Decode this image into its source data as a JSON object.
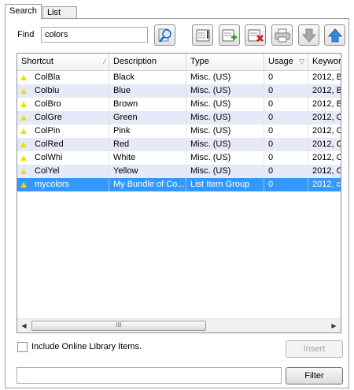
{
  "tabs": [
    {
      "label": "Search",
      "active": true
    },
    {
      "label": "List",
      "active": false
    }
  ],
  "find": {
    "label": "Find",
    "value": "colors"
  },
  "toolbar": {
    "buttons": [
      "search-library-icon",
      "edit-item-icon",
      "add-item-icon",
      "delete-item-icon",
      "print-icon",
      "move-down-icon",
      "move-up-icon"
    ]
  },
  "grid": {
    "columns": [
      "Shortcut",
      "Description",
      "Type",
      "Usage",
      "Keywor"
    ],
    "rows": [
      {
        "shortcut": "ColBla",
        "description": "Black",
        "type": "Misc. (US)",
        "usage": "0",
        "keywords": "2012, B"
      },
      {
        "shortcut": "Colblu",
        "description": "Blue",
        "type": "Misc. (US)",
        "usage": "0",
        "keywords": "2012, B"
      },
      {
        "shortcut": "ColBro",
        "description": "Brown",
        "type": "Misc. (US)",
        "usage": "0",
        "keywords": "2012, B"
      },
      {
        "shortcut": "ColGre",
        "description": "Green",
        "type": "Misc. (US)",
        "usage": "0",
        "keywords": "2012, C"
      },
      {
        "shortcut": "ColPin",
        "description": "Pink",
        "type": "Misc. (US)",
        "usage": "0",
        "keywords": "2012, C"
      },
      {
        "shortcut": "ColRed",
        "description": "Red",
        "type": "Misc. (US)",
        "usage": "0",
        "keywords": "2012, C"
      },
      {
        "shortcut": "ColWhi",
        "description": "White",
        "type": "Misc. (US)",
        "usage": "0",
        "keywords": "2012, C"
      },
      {
        "shortcut": "ColYel",
        "description": "Yellow",
        "type": "Misc. (US)",
        "usage": "0",
        "keywords": "2012, C"
      },
      {
        "shortcut": "mycolors",
        "description": "My Bundle of Co...",
        "type": "List Item Group",
        "usage": "0",
        "keywords": "2012, c",
        "selected": true
      }
    ],
    "scroll_thumb_label": "III"
  },
  "include_online": {
    "label": "Include Online Library Items."
  },
  "insert_label": "Insert",
  "filter": {
    "value": "",
    "button_label": "Filter"
  },
  "colors": {
    "selected_row": "#3399ff",
    "alt_row": "#e6eaf8",
    "row_icon": "#e8e000"
  }
}
